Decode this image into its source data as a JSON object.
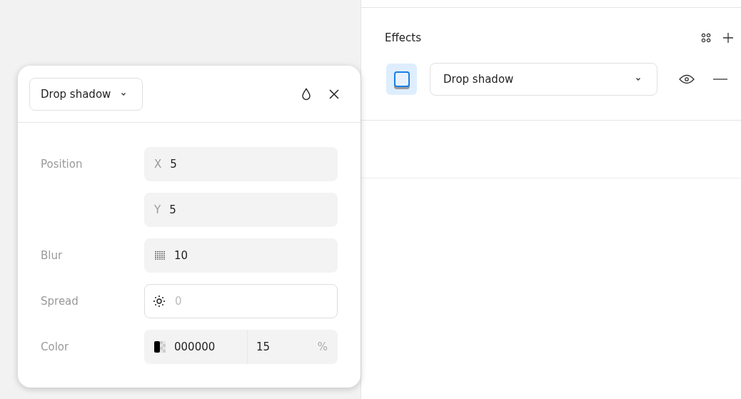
{
  "popup": {
    "effect_type": "Drop shadow",
    "rows": [
      {
        "label": "Position",
        "kind": "x",
        "prefix": "X",
        "value": "5"
      },
      {
        "kind": "y",
        "prefix": "Y",
        "value": "5"
      },
      {
        "label": "Blur",
        "kind": "blur",
        "value": "10"
      },
      {
        "label": "Spread",
        "kind": "spread",
        "placeholder": "0"
      },
      {
        "label": "Color",
        "kind": "color",
        "value": "000000",
        "opacity": "15",
        "unit": "%"
      }
    ]
  },
  "effects_panel": {
    "title": "Effects",
    "effects": [
      {
        "type": "Drop shadow"
      }
    ]
  }
}
